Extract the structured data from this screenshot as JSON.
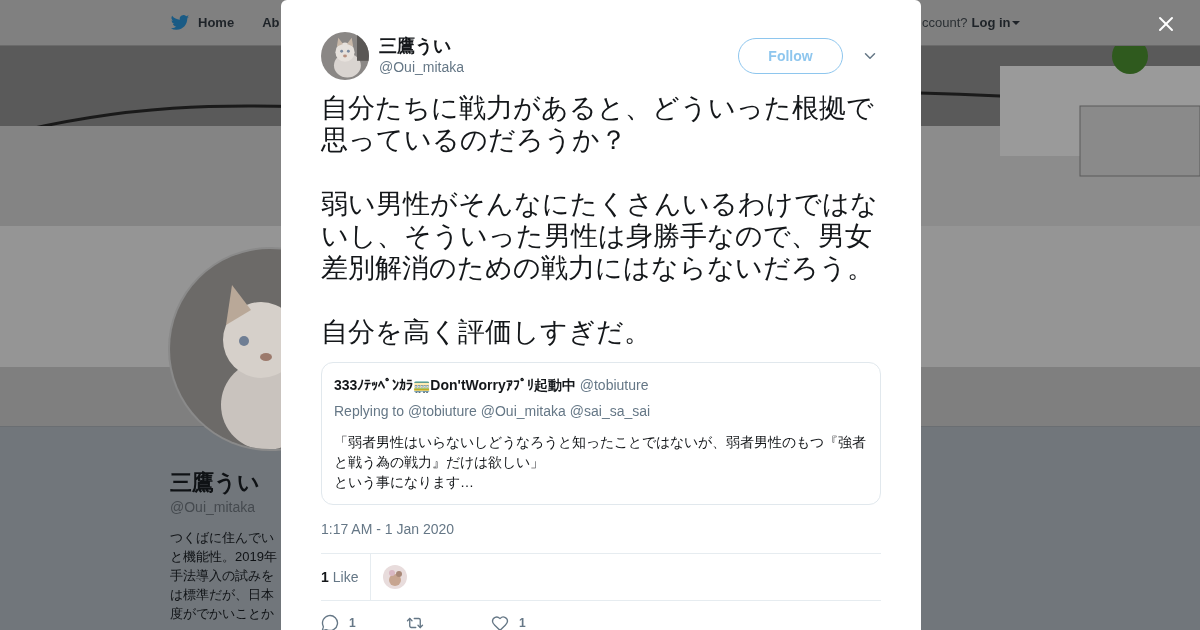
{
  "nav": {
    "items": [
      {
        "label": "Home",
        "selected": false
      },
      {
        "label": "Ab",
        "selected": false
      }
    ],
    "account_prompt": "ccount?",
    "login": "Log in"
  },
  "profile": {
    "name": "三鷹うい",
    "handle": "@Oui_mitaka",
    "bio_lines": [
      "つくばに住んでい",
      "と機能性。2019年",
      "手法導入の試みを",
      "は標準だが、日本",
      "度がでかいことか"
    ]
  },
  "tweet": {
    "author": {
      "name": "三鷹うい",
      "handle": "@Oui_mitaka"
    },
    "follow": "Follow",
    "text": [
      "自分たちに戦力があると、どういった根拠で思っているのだろうか？",
      "弱い男性がそんなにたくさんいるわけではないし、そういった男性は身勝手なので、男女差別解消のための戦力にはならないだろう。",
      "自分を高く評価しすぎだ。"
    ],
    "quoted": {
      "name": "333ﾉﾃｯﾍﾟﾝｶﾗ🚃Don'tWorryｱﾌﾟﾘ起動中",
      "handle": "@tobiuture",
      "replying": "Replying to",
      "mentions": [
        "@tobiuture",
        "@Oui_mitaka",
        "@sai_sa_sai"
      ],
      "text": [
        "「弱者男性はいらないしどうなろうと知ったことではないが、弱者男性のもつ『強者と戦う為の戦力』だけは欲しい」",
        "という事になります…"
      ]
    },
    "timestamp": "1:17 AM - 1 Jan 2020",
    "likes": {
      "count": "1",
      "label": "Like"
    },
    "actions": [
      {
        "kind": "reply",
        "count": "1"
      },
      {
        "kind": "retweet"
      },
      {
        "kind": "like",
        "count": "1"
      }
    ]
  }
}
